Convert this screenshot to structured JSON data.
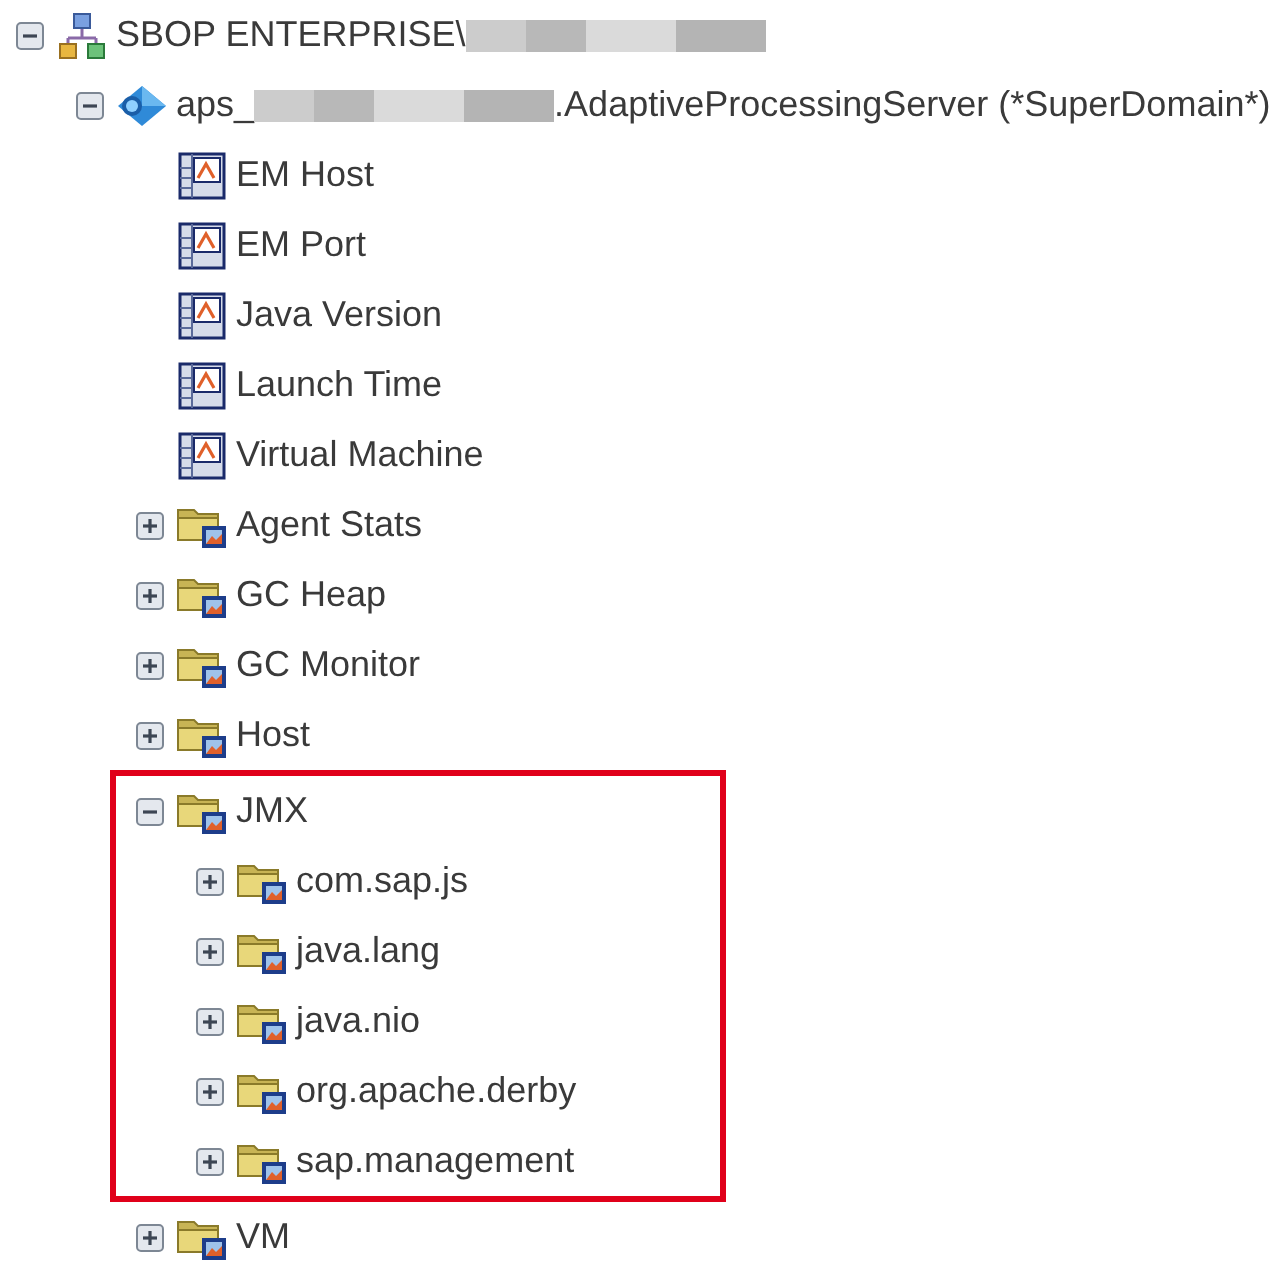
{
  "tree": [
    {
      "kind": "domain",
      "label": "SBOP ENTERPRISE\\",
      "redacted": true,
      "expanded": true,
      "children": [
        {
          "kind": "process",
          "label": "aps_",
          "redacted": true,
          "label_after": ".AdaptiveProcessingServer (*SuperDomain*)",
          "expanded": true,
          "children": [
            {
              "kind": "metric",
              "label": "EM Host"
            },
            {
              "kind": "metric",
              "label": "EM Port"
            },
            {
              "kind": "metric",
              "label": "Java Version"
            },
            {
              "kind": "metric",
              "label": "Launch Time"
            },
            {
              "kind": "metric",
              "label": "Virtual Machine"
            },
            {
              "kind": "folder",
              "label": "Agent Stats",
              "expanded": false
            },
            {
              "kind": "folder",
              "label": "GC Heap",
              "expanded": false
            },
            {
              "kind": "folder",
              "label": "GC Monitor",
              "expanded": false
            },
            {
              "kind": "folder",
              "label": "Host",
              "expanded": false
            },
            {
              "kind": "folder",
              "label": "JMX",
              "expanded": true,
              "highlighted": true,
              "children": [
                {
                  "kind": "folder",
                  "label": "com.sap.js",
                  "expanded": false
                },
                {
                  "kind": "folder",
                  "label": "java.lang",
                  "expanded": false
                },
                {
                  "kind": "folder",
                  "label": "java.nio",
                  "expanded": false
                },
                {
                  "kind": "folder",
                  "label": "org.apache.derby",
                  "expanded": false
                },
                {
                  "kind": "folder",
                  "label": "sap.management",
                  "expanded": false
                }
              ]
            },
            {
              "kind": "folder",
              "label": "VM",
              "expanded": false
            }
          ]
        }
      ]
    }
  ]
}
